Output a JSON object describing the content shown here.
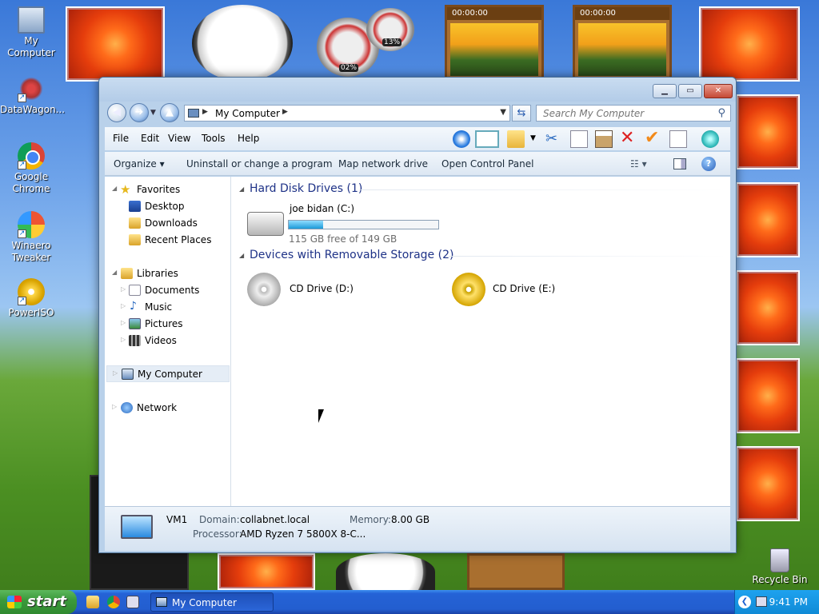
{
  "desktop": {
    "icons": [
      {
        "label": "My Computer"
      },
      {
        "label": "DataWagon..."
      },
      {
        "label": "Google Chrome"
      },
      {
        "label": "Winaero Tweaker"
      },
      {
        "label": "PowerISO"
      },
      {
        "label": "Recycle Bin"
      }
    ],
    "gadgets": {
      "video_time_1": "00:00:00",
      "video_time_2": "00:00:00",
      "meter_cpu": "02%",
      "meter_mem": "13%"
    }
  },
  "window": {
    "address": "My Computer",
    "search_placeholder": "Search My Computer",
    "controls": {
      "minimize": "▁",
      "maximize": "▭",
      "close": "✕"
    },
    "menu": [
      "File",
      "Edit",
      "View",
      "Tools",
      "Help"
    ],
    "commands": [
      "Organize ▾",
      "Uninstall or change a program",
      "Map network drive",
      "Open Control Panel"
    ],
    "nav": {
      "favorites": "Favorites",
      "favorites_items": [
        "Desktop",
        "Downloads",
        "Recent Places"
      ],
      "libraries": "Libraries",
      "libraries_items": [
        "Documents",
        "Music",
        "Pictures",
        "Videos"
      ],
      "my_computer": "My Computer",
      "network": "Network"
    },
    "groups": {
      "hdd_title": "Hard Disk Drives (1)",
      "removable_title": "Devices with Removable Storage (2)"
    },
    "drives": {
      "c_name": "joe bidan (C:)",
      "c_free": "115 GB free of 149 GB",
      "c_used_fraction": 0.23,
      "d_name": "CD Drive (D:)",
      "e_name": "CD Drive (E:)"
    },
    "details": {
      "name": "VM1",
      "domain_label": "Domain:",
      "domain_value": "collabnet.local",
      "memory_label": "Memory:",
      "memory_value": "8.00 GB",
      "processor_label": "Processor:",
      "processor_value": "AMD Ryzen 7 5800X 8-C..."
    }
  },
  "taskbar": {
    "start": "start",
    "task": "My Computer",
    "clock": "9:41 PM"
  }
}
